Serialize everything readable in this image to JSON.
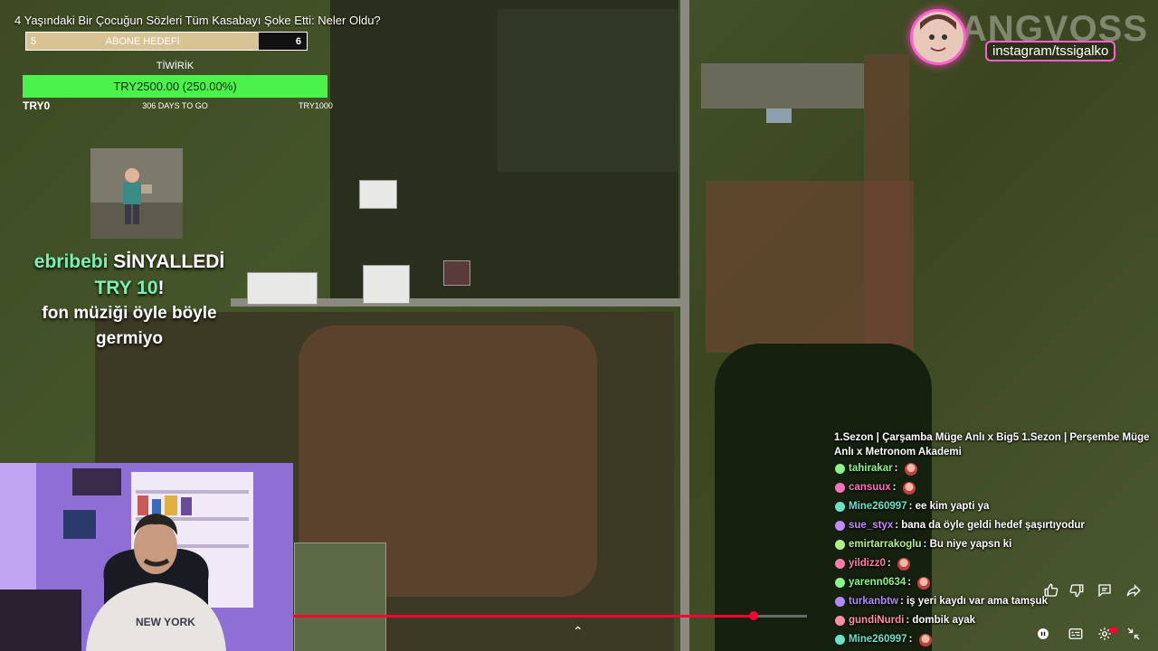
{
  "video": {
    "title": "4 Yaşındaki Bir Çocuğun Sözleri Tüm Kasabayı Şoke Etti: Neler Oldu?",
    "progress": 0.896
  },
  "sub_goal": {
    "current": "5",
    "label": "ABONE HEDEFİ",
    "target": "6",
    "progress": 0.83
  },
  "tip_goal": {
    "title": "TİWİRİK",
    "amount": "TRY2500.00 (250.00%)",
    "min": "TRY0",
    "days_left": "306 DAYS TO GO",
    "max": "TRY1000"
  },
  "alert": {
    "user": "ebribebi",
    "action": "SİNYALLEDİ",
    "amount": "TRY 10",
    "amount_suffix": "!",
    "message": "fon müziği öyle böyle germiyo"
  },
  "brand": {
    "word": "ANGVOSS",
    "instagram": "instagram/tssigalko"
  },
  "chat": {
    "pinned": "1.Sezon | Çarşamba Müge Anlı x Big5 1.Sezon | Perşembe Müge Anlı x Metronom Akademi",
    "messages": [
      {
        "user": "tahirakar",
        "color": "#8cf58c",
        "text": "",
        "emote": true
      },
      {
        "user": "cansuux",
        "color": "#ff6fc1",
        "text": "",
        "emote": true
      },
      {
        "user": "Mine260997",
        "color": "#6de0c8",
        "text": "ee kim yapti ya",
        "emote": false
      },
      {
        "user": "sue_styx",
        "color": "#c488ff",
        "text": "bana da öyle geldi hedef şaşırtıyodur",
        "emote": false
      },
      {
        "user": "emirtarrakoglu",
        "color": "#b2f08c",
        "text": "Bu niye yapsn ki",
        "emote": false
      },
      {
        "user": "yildizz0",
        "color": "#ff7aa8",
        "text": "",
        "emote": true
      },
      {
        "user": "yarenn0634",
        "color": "#8cf58c",
        "text": "",
        "emote": true
      },
      {
        "user": "turkanbtw",
        "color": "#b388ff",
        "text": "iş yeri kaydı var ama tamşuk",
        "emote": false
      },
      {
        "user": "gundiNurdi",
        "color": "#ff8fa6",
        "text": "dombik ayak",
        "emote": false
      },
      {
        "user": "Mine260997",
        "color": "#6de0c8",
        "text": "",
        "emote": true
      }
    ]
  },
  "icons": [
    "like-icon",
    "dislike-icon",
    "comment-icon",
    "share-icon",
    "autoplay-icon",
    "subtitles-icon",
    "settings-icon",
    "minimize-icon",
    "chevron-up-icon"
  ]
}
